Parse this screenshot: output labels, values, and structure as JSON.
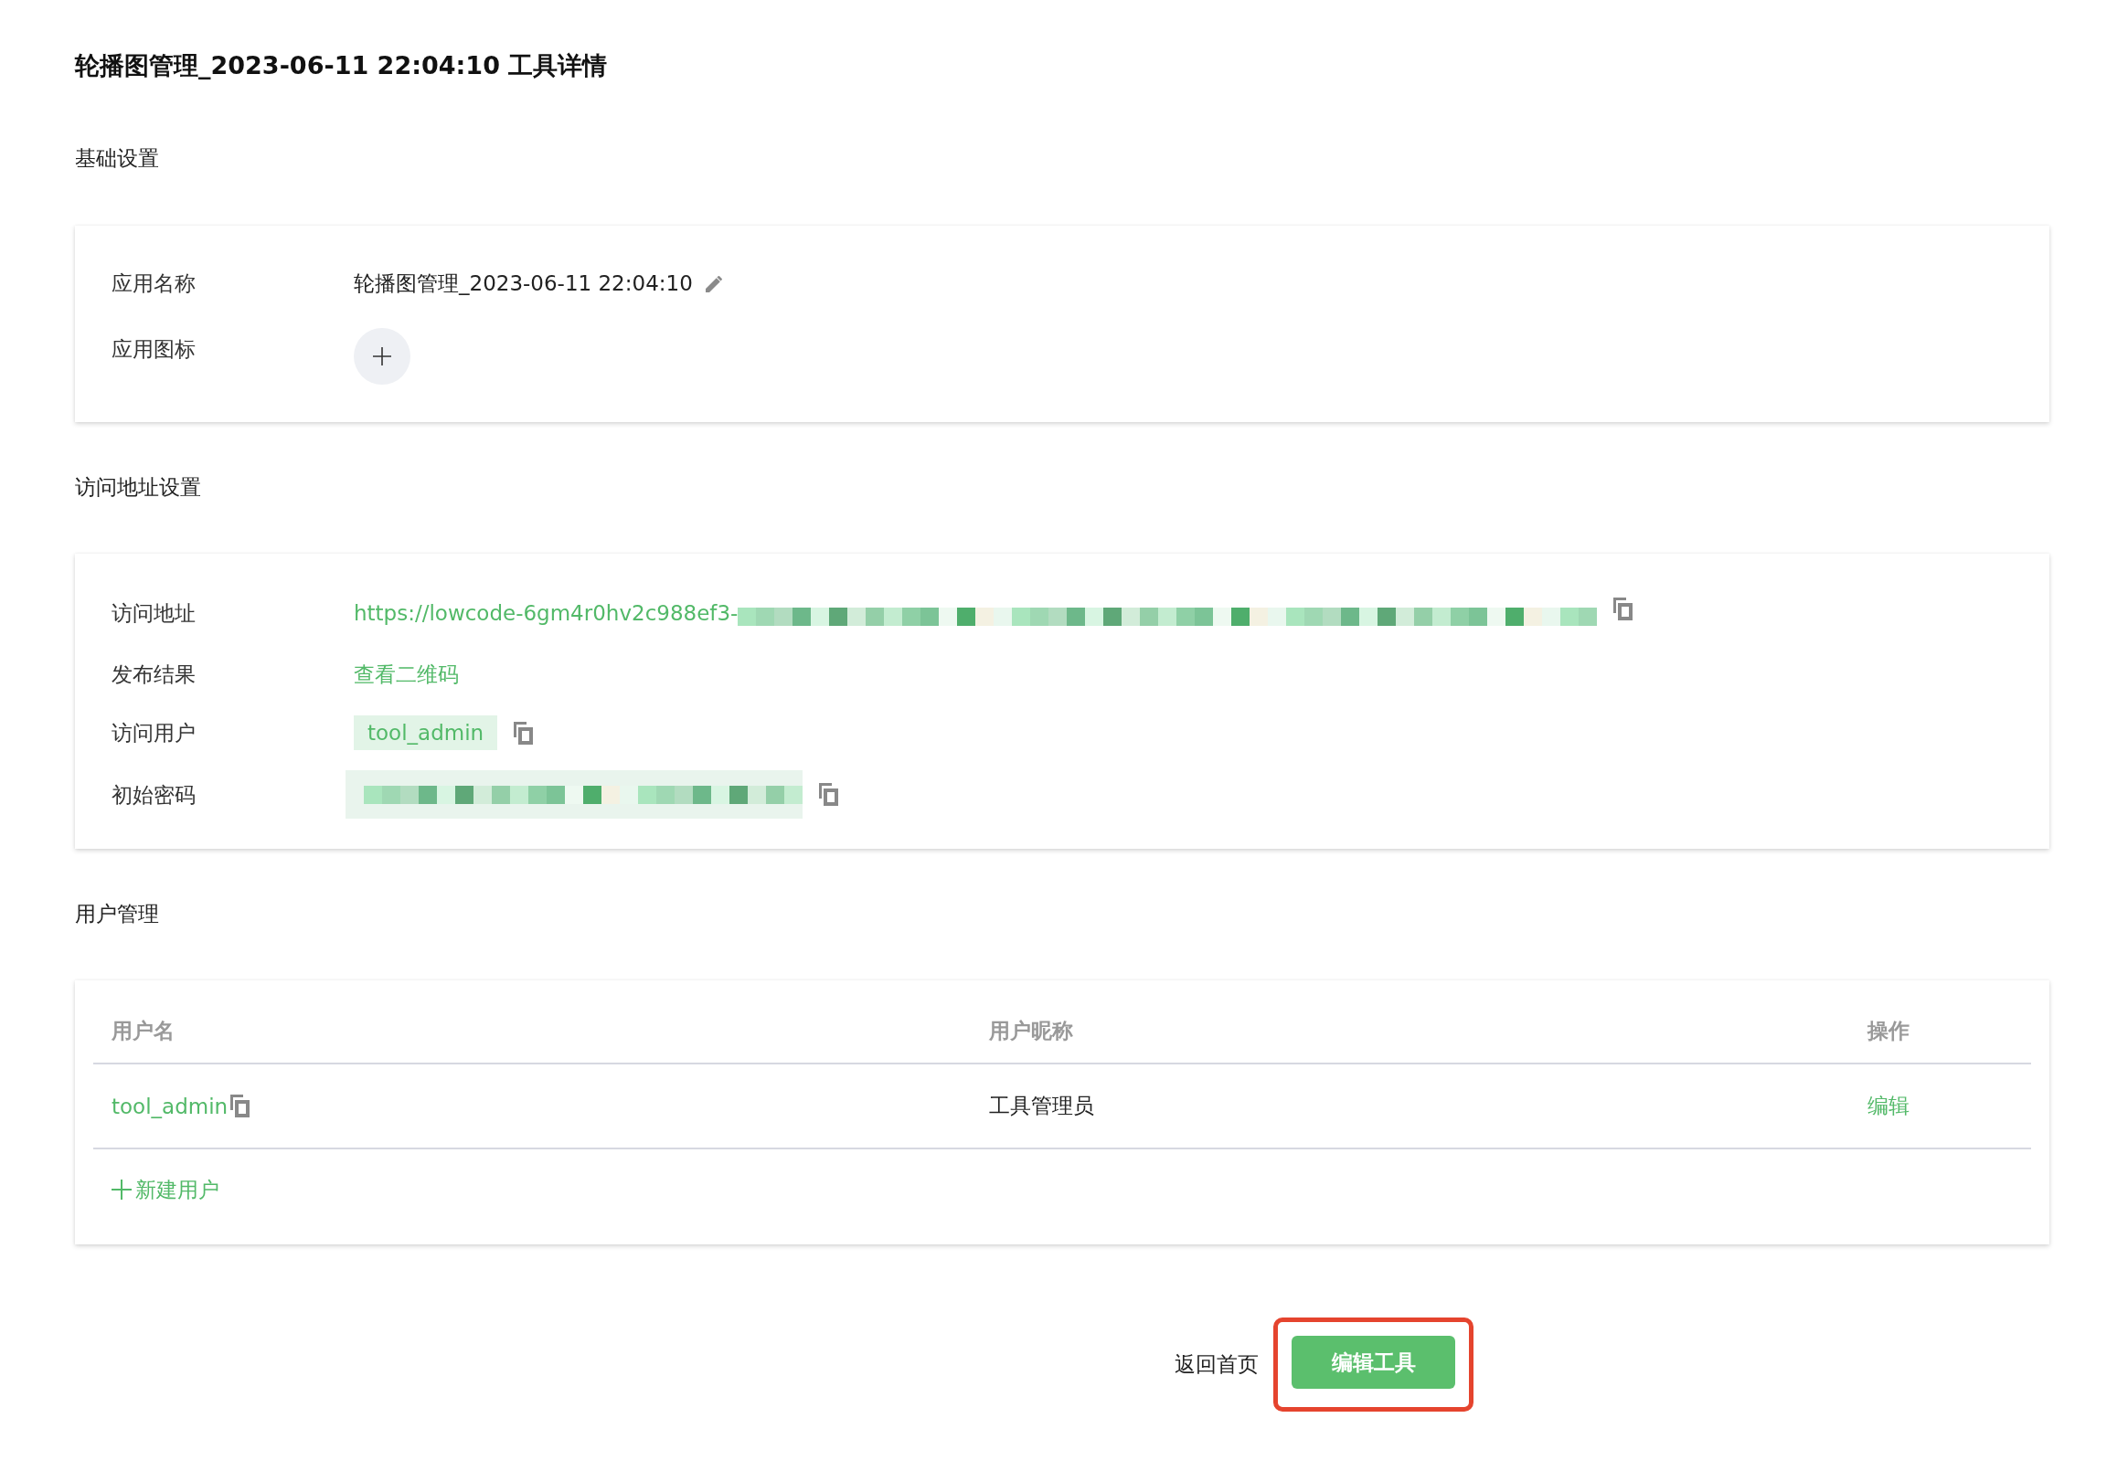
{
  "page": {
    "title": "轮播图管理_2023-06-11 22:04:10 工具详情"
  },
  "sections": [
    {
      "kind": "form",
      "heading": "基础设置",
      "fields": [
        {
          "kind": "editable_text",
          "label": "应用名称",
          "value": "轮播图管理_2023-06-11 22:04:10",
          "copyable": false
        },
        {
          "kind": "icon_upload",
          "label": "应用图标",
          "copyable": false
        }
      ]
    },
    {
      "kind": "form",
      "heading": "访问地址设置",
      "fields": [
        {
          "kind": "link",
          "label": "访问地址",
          "value": "https://lowcode-6gm4r0hv2c988ef3-",
          "redacted": true,
          "copyable": true
        },
        {
          "kind": "link",
          "label": "发布结果",
          "value": "查看二维码",
          "copyable": false
        },
        {
          "kind": "tag",
          "label": "访问用户",
          "value": "tool_admin",
          "copyable": true
        },
        {
          "kind": "secret",
          "label": "初始密码",
          "redacted": true,
          "copyable": true
        }
      ]
    },
    {
      "kind": "table",
      "heading": "用户管理",
      "table": {
        "columns": [
          "用户名",
          "用户昵称",
          "操作"
        ],
        "rows": [
          {
            "cells": [
              {
                "kind": "link",
                "text": "tool_admin",
                "copyable": true
              },
              {
                "kind": "text",
                "text": "工具管理员"
              },
              {
                "kind": "link",
                "text": "编辑"
              }
            ]
          }
        ]
      },
      "add_button": "新建用户"
    }
  ],
  "footer": {
    "buttons": [
      {
        "kind": "text",
        "label": "返回首页",
        "highlighted": false
      },
      {
        "kind": "primary",
        "label": "编辑工具",
        "highlighted": true
      }
    ]
  }
}
